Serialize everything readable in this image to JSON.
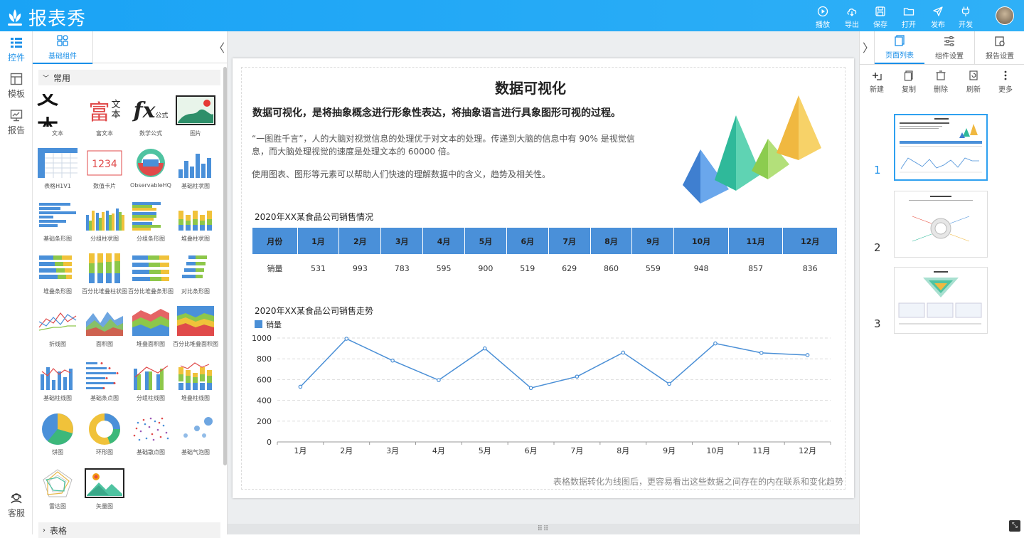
{
  "app": {
    "title": "报表秀"
  },
  "toolbar": {
    "play": "播放",
    "export": "导出",
    "save": "保存",
    "open": "打开",
    "publish": "发布",
    "dev": "开发"
  },
  "leftnav": {
    "controls": "控件",
    "templates": "模板",
    "reports": "报告",
    "service": "客服"
  },
  "panel": {
    "tab_label": "基础组件",
    "group_common": "常用",
    "group_table": "表格",
    "components": [
      {
        "label": "文本",
        "icon": "text-big"
      },
      {
        "label": "富文本",
        "icon": "rich-text"
      },
      {
        "label": "数学公式",
        "icon": "formula"
      },
      {
        "label": "图片",
        "icon": "image"
      },
      {
        "label": "表格H1V1",
        "icon": "table"
      },
      {
        "label": "数值卡片",
        "icon": "number-card"
      },
      {
        "label": "ObservableHQ",
        "icon": "observable"
      },
      {
        "label": "基础柱状图",
        "icon": "bar"
      },
      {
        "label": "基础条形图",
        "icon": "hbar"
      },
      {
        "label": "分组柱状图",
        "icon": "group-bar"
      },
      {
        "label": "分组条形图",
        "icon": "group-hbar"
      },
      {
        "label": "堆叠柱状图",
        "icon": "stack-bar"
      },
      {
        "label": "堆叠条形图",
        "icon": "stack-hbar"
      },
      {
        "label": "百分比堆叠柱状图",
        "icon": "pct-bar"
      },
      {
        "label": "百分比堆叠条形图",
        "icon": "pct-hbar"
      },
      {
        "label": "对比条形图",
        "icon": "compare-hbar"
      },
      {
        "label": "折线图",
        "icon": "line"
      },
      {
        "label": "面积图",
        "icon": "area"
      },
      {
        "label": "堆叠面积图",
        "icon": "stack-area"
      },
      {
        "label": "百分比堆叠面积图",
        "icon": "pct-area"
      },
      {
        "label": "基础柱线图",
        "icon": "bar-line"
      },
      {
        "label": "基础条点图",
        "icon": "hbar-dot"
      },
      {
        "label": "分组柱线图",
        "icon": "group-bar-line"
      },
      {
        "label": "堆叠柱线图",
        "icon": "stack-bar-line"
      },
      {
        "label": "饼图",
        "icon": "pie"
      },
      {
        "label": "环形图",
        "icon": "donut"
      },
      {
        "label": "基础散点图",
        "icon": "scatter"
      },
      {
        "label": "基础气泡图",
        "icon": "bubble"
      },
      {
        "label": "雷达图",
        "icon": "radar"
      },
      {
        "label": "矢量图",
        "icon": "vector"
      }
    ]
  },
  "rightpanel": {
    "tabs": [
      "页面列表",
      "组件设置",
      "报告设置"
    ],
    "actions": [
      "新建",
      "复制",
      "删除",
      "刷新",
      "更多"
    ],
    "pages": [
      "1",
      "2",
      "3"
    ],
    "selected_page": "1"
  },
  "report": {
    "title": "数据可视化",
    "subtitle": "数据可视化，是将抽象概念进行形象性表达，将抽象语言进行具象图形可视的过程。",
    "para1": "“一图胜千言”，人的大脑对视觉信息的处理优于对文本的处理。传递到大脑的信息中有 90% 是视觉信息，而大脑处理视觉的速度是处理文本的 60000 倍。",
    "para2": "使用图表、图形等元素可以帮助人们快速的理解数据中的含义，趋势及相关性。",
    "table_title": "2020年XX某食品公司销售情况",
    "table_header": [
      "月份",
      "1月",
      "2月",
      "3月",
      "4月",
      "5月",
      "6月",
      "7月",
      "8月",
      "9月",
      "10月",
      "11月",
      "12月"
    ],
    "table_row": [
      "销量",
      "531",
      "993",
      "783",
      "595",
      "900",
      "519",
      "629",
      "860",
      "559",
      "948",
      "857",
      "836"
    ],
    "chart_title": "2020年XX某食品公司销售走势",
    "footnote": "表格数据转化为线图后，更容易看出这些数据之间存在的内在联系和变化趋势"
  },
  "colors": {
    "accent": "#1a8fe8",
    "topbar": "#1ea6f6",
    "table_header": "#4a90d9",
    "line": "#4a8fd6"
  },
  "chart_data": {
    "type": "line",
    "title": "2020年XX某食品公司销售走势",
    "categories": [
      "1月",
      "2月",
      "3月",
      "4月",
      "5月",
      "6月",
      "7月",
      "8月",
      "9月",
      "10月",
      "11月",
      "12月"
    ],
    "series": [
      {
        "name": "销量",
        "values": [
          531,
          993,
          783,
          595,
          900,
          519,
          629,
          860,
          559,
          948,
          857,
          836
        ]
      }
    ],
    "ylim": [
      0,
      1000
    ],
    "yticks": [
      "0",
      "200",
      "400",
      "600",
      "800",
      "1000"
    ],
    "grid": true,
    "legend": "top-left"
  }
}
